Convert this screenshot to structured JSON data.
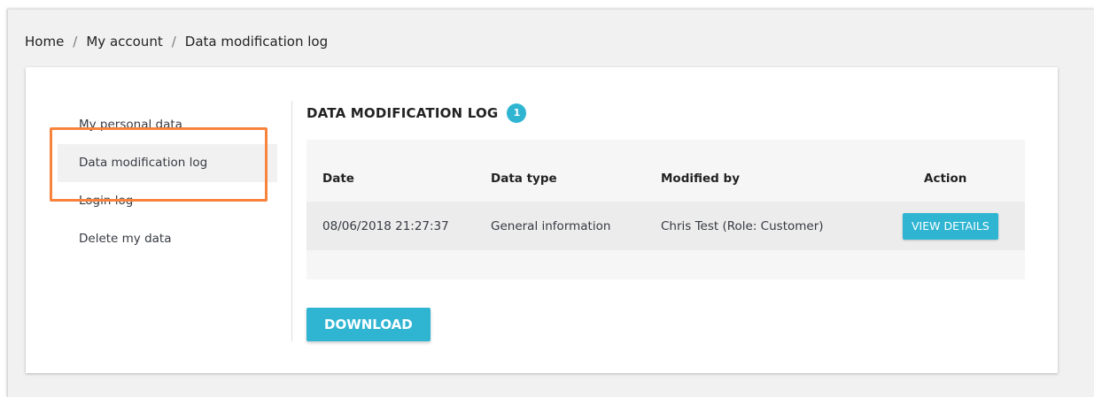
{
  "breadcrumb": {
    "items": [
      "Home",
      "My account",
      "Data modification log"
    ],
    "separator": "/"
  },
  "sidebar": {
    "items": [
      {
        "label": "My personal data"
      },
      {
        "label": "Data modification log",
        "active": true
      },
      {
        "label": "Login log"
      },
      {
        "label": "Delete my data"
      }
    ]
  },
  "main": {
    "title": "DATA MODIFICATION LOG",
    "count": "1",
    "table": {
      "headers": [
        "Date",
        "Data type",
        "Modified by",
        "Action"
      ],
      "rows": [
        {
          "date": "08/06/2018 21:27:37",
          "data_type": "General information",
          "modified_by": "Chris Test (Role: Customer)",
          "action_label": "VIEW DETAILS"
        }
      ]
    },
    "download_label": "DOWNLOAD"
  },
  "colors": {
    "accent": "#2fb5d2",
    "highlight": "#f7833c",
    "background": "#f1f1f1"
  }
}
